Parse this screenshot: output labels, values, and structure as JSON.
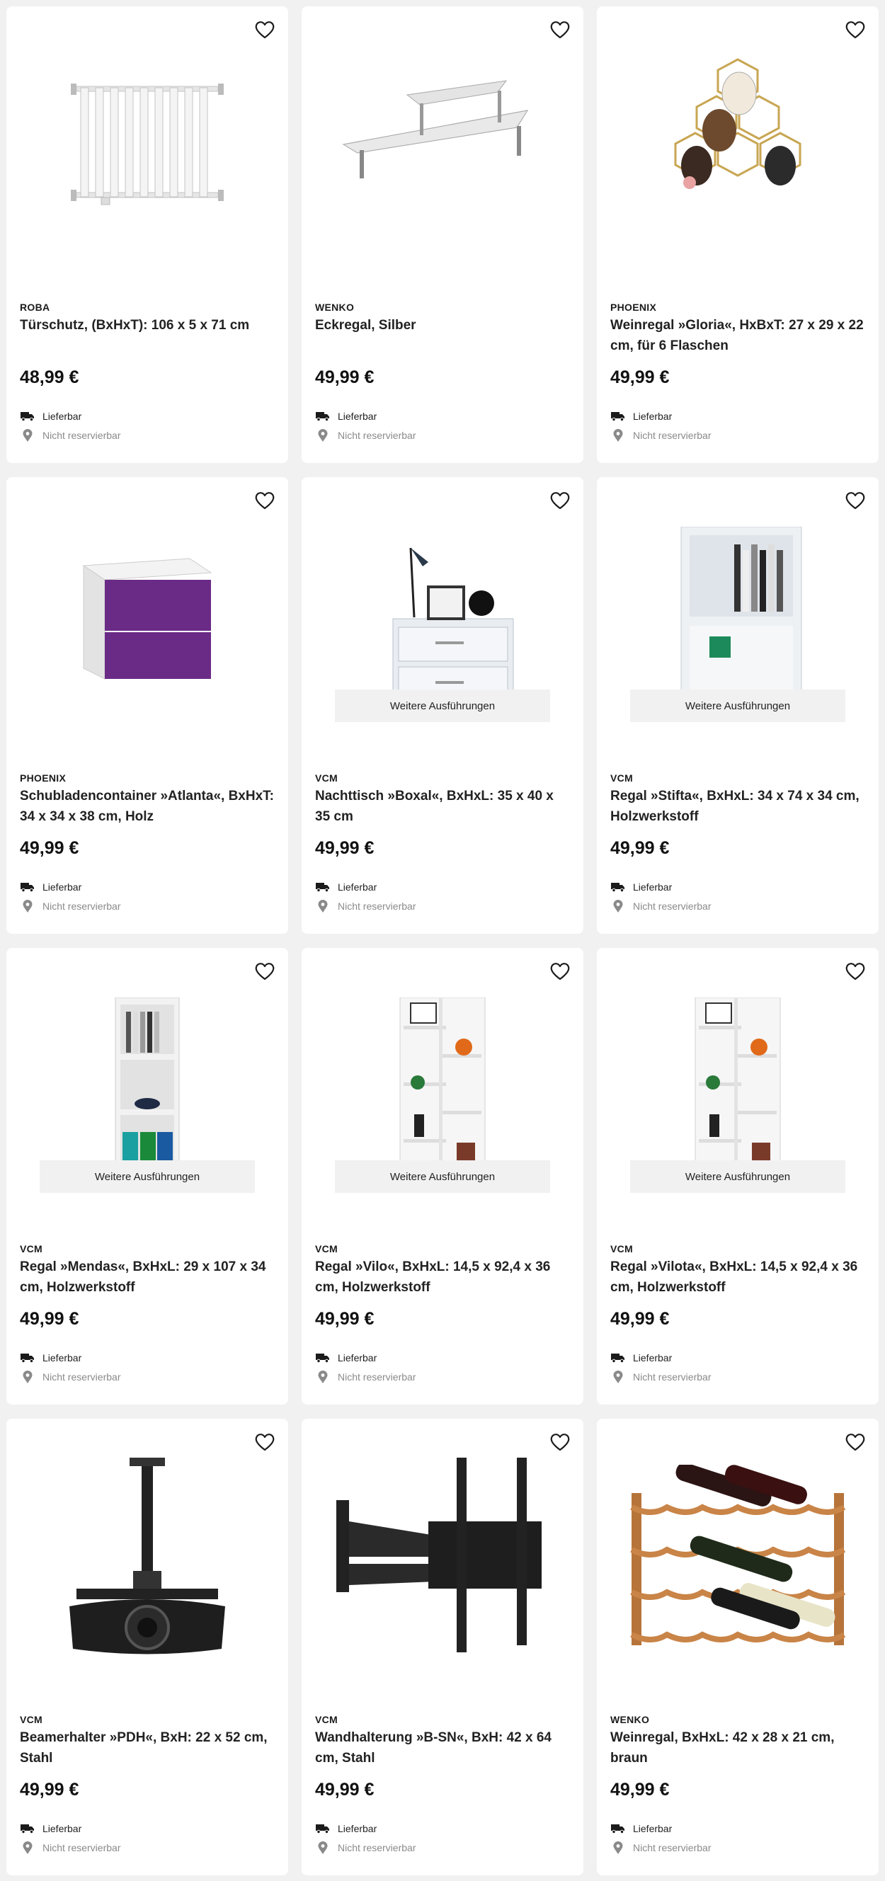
{
  "products": [
    {
      "brand": "ROBA",
      "title": "Türschutz, (BxHxT): 106 x 5 x 71 cm",
      "price": "48,99 €",
      "delivery": "Lieferbar",
      "reserve": "Nicht reservierbar",
      "image": "safety-gate",
      "variants": null
    },
    {
      "brand": "WENKO",
      "title": "Eckregal, Silber",
      "price": "49,99 €",
      "delivery": "Lieferbar",
      "reserve": "Nicht reservierbar",
      "image": "corner-shelf",
      "variants": null
    },
    {
      "brand": "PHOENIX",
      "title": "Weinregal »Gloria«, HxBxT: 27 x 29 x 22 cm, für 6 Flaschen",
      "price": "49,99 €",
      "delivery": "Lieferbar",
      "reserve": "Nicht reservierbar",
      "image": "hexagon-wine-rack",
      "variants": null
    },
    {
      "brand": "PHOENIX",
      "title": "Schubladencontainer »Atlanta«, BxHxT: 34 x 34 x 38 cm, Holz",
      "price": "49,99 €",
      "delivery": "Lieferbar",
      "reserve": "Nicht reservierbar",
      "image": "drawer-container",
      "variants": null
    },
    {
      "brand": "VCM",
      "title": "Nachttisch »Boxal«, BxHxL: 35 x 40 x 35 cm",
      "price": "49,99 €",
      "delivery": "Lieferbar",
      "reserve": "Nicht reservierbar",
      "image": "nightstand",
      "variants": "Weitere Ausführungen"
    },
    {
      "brand": "VCM",
      "title": "Regal »Stifta«, BxHxL: 34 x 74 x 34 cm, Holzwerkstoff",
      "price": "49,99 €",
      "delivery": "Lieferbar",
      "reserve": "Nicht reservierbar",
      "image": "cube-shelf",
      "variants": "Weitere Ausführungen"
    },
    {
      "brand": "VCM",
      "title": "Regal »Mendas«, BxHxL: 29 x 107 x 34 cm, Holzwerkstoff",
      "price": "49,99 €",
      "delivery": "Lieferbar",
      "reserve": "Nicht reservierbar",
      "image": "tall-shelf",
      "variants": "Weitere Ausführungen"
    },
    {
      "brand": "VCM",
      "title": "Regal »Vilo«, BxHxL: 14,5 x 92,4 x 36 cm, Holzwerkstoff",
      "price": "49,99 €",
      "delivery": "Lieferbar",
      "reserve": "Nicht reservierbar",
      "image": "zigzag-shelf",
      "variants": "Weitere Ausführungen"
    },
    {
      "brand": "VCM",
      "title": "Regal »Vilota«, BxHxL: 14,5 x 92,4 x 36 cm, Holzwerkstoff",
      "price": "49,99 €",
      "delivery": "Lieferbar",
      "reserve": "Nicht reservierbar",
      "image": "zigzag-shelf",
      "variants": "Weitere Ausführungen"
    },
    {
      "brand": "VCM",
      "title": "Beamerhalter »PDH«, BxH: 22 x 52 cm, Stahl",
      "price": "49,99 €",
      "delivery": "Lieferbar",
      "reserve": "Nicht reservierbar",
      "image": "projector-mount",
      "variants": null
    },
    {
      "brand": "VCM",
      "title": "Wandhalterung »B-SN«, BxH: 42 x 64 cm, Stahl",
      "price": "49,99 €",
      "delivery": "Lieferbar",
      "reserve": "Nicht reservierbar",
      "image": "tv-wall-mount",
      "variants": null
    },
    {
      "brand": "WENKO",
      "title": "Weinregal, BxHxL: 42 x 28 x 21 cm, braun",
      "price": "49,99 €",
      "delivery": "Lieferbar",
      "reserve": "Nicht reservierbar",
      "image": "wooden-wine-rack",
      "variants": null
    }
  ],
  "colors": {
    "background": "#f1f1f1",
    "card": "#ffffff",
    "text": "#1b1b1b",
    "muted": "#8a8a8a"
  }
}
